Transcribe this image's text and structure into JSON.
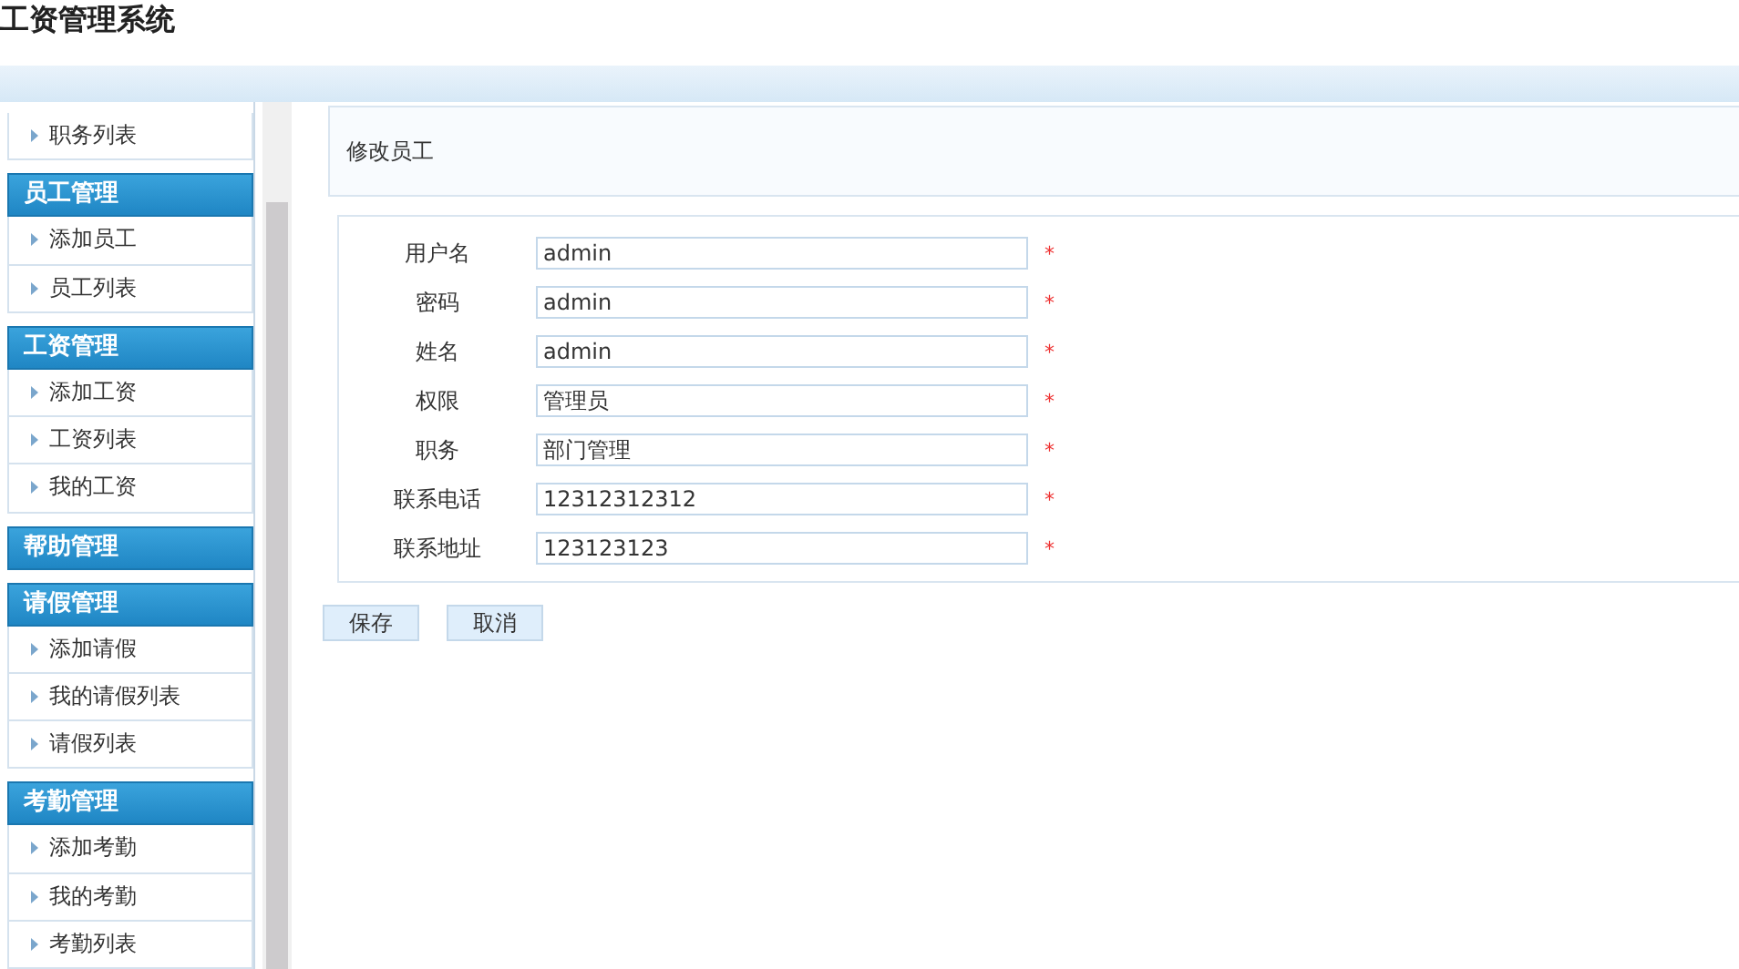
{
  "app_title": "工资管理系统",
  "sidebar": [
    {
      "kind": "item",
      "label": "职务列表"
    },
    {
      "kind": "header",
      "label": "员工管理"
    },
    {
      "kind": "item",
      "label": "添加员工"
    },
    {
      "kind": "item",
      "label": "员工列表"
    },
    {
      "kind": "header",
      "label": "工资管理"
    },
    {
      "kind": "item",
      "label": "添加工资"
    },
    {
      "kind": "item",
      "label": "工资列表"
    },
    {
      "kind": "item",
      "label": "我的工资"
    },
    {
      "kind": "header",
      "label": "帮助管理"
    },
    {
      "kind": "header",
      "label": "请假管理"
    },
    {
      "kind": "item",
      "label": "添加请假"
    },
    {
      "kind": "item",
      "label": "我的请假列表"
    },
    {
      "kind": "item",
      "label": "请假列表"
    },
    {
      "kind": "header",
      "label": "考勤管理"
    },
    {
      "kind": "item",
      "label": "添加考勤"
    },
    {
      "kind": "item",
      "label": "我的考勤"
    },
    {
      "kind": "item",
      "label": "考勤列表"
    }
  ],
  "page_title": "修改员工",
  "form": [
    {
      "label": "用户名",
      "value": "admin",
      "required": "*"
    },
    {
      "label": "密码",
      "value": "admin",
      "required": "*"
    },
    {
      "label": "姓名",
      "value": "admin",
      "required": "*"
    },
    {
      "label": "权限",
      "value": "管理员",
      "required": "*"
    },
    {
      "label": "职务",
      "value": "部门管理",
      "required": "*"
    },
    {
      "label": "联系电话",
      "value": "12312312312",
      "required": "*"
    },
    {
      "label": "联系地址",
      "value": "123123123",
      "required": "*"
    }
  ],
  "buttons": [
    "保存",
    "取消"
  ]
}
